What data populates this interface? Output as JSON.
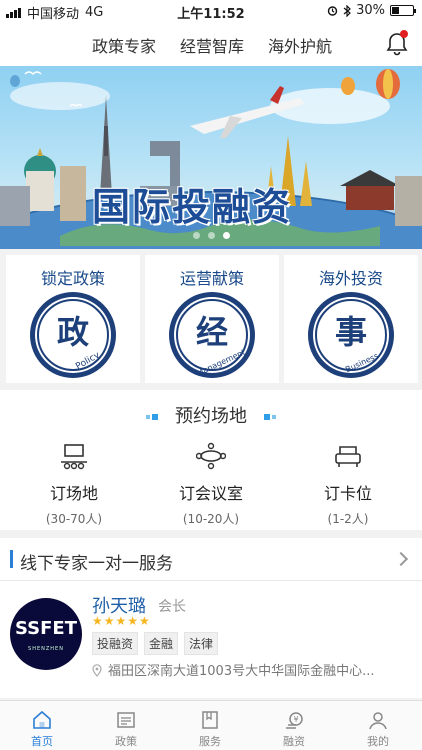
{
  "status_bar": {
    "carrier": "中国移动",
    "network": "4G",
    "time": "上午11:52",
    "battery": "30%"
  },
  "top_nav": {
    "tabs": [
      "政策专家",
      "经营智库",
      "海外护航"
    ]
  },
  "banner": {
    "title": "国际投融资",
    "page_count": 3,
    "active_page": 3
  },
  "policy_cards": [
    {
      "title": "锁定政策",
      "char": "政",
      "sub": "Policy"
    },
    {
      "title": "运营献策",
      "char": "经",
      "sub": "Management"
    },
    {
      "title": "海外投资",
      "char": "事",
      "sub": "Business"
    }
  ],
  "venue": {
    "heading": "预约场地",
    "items": [
      {
        "name": "订场地",
        "capacity": "(30-70人)"
      },
      {
        "name": "订会议室",
        "capacity": "(10-20人)"
      },
      {
        "name": "订卡位",
        "capacity": "(1-2人)"
      }
    ]
  },
  "expert_section": {
    "title": "线下专家一对一服务",
    "expert": {
      "logo_text": "SSFET",
      "logo_sub": "SHENZHEN",
      "name": "孙天璐",
      "role": "会长",
      "rating": 5,
      "stars": "★★★★★",
      "tags": [
        "投融资",
        "金融",
        "法律"
      ],
      "address": "福田区深南大道1003号大中华国际金融中心..."
    }
  },
  "tab_bar": {
    "items": [
      "首页",
      "政策",
      "服务",
      "融资",
      "我的"
    ],
    "active": "首页"
  },
  "colors": {
    "brand_blue": "#1d4d96",
    "accent": "#2b7fd6",
    "badge_red": "#e02020",
    "star": "#f5b621"
  }
}
